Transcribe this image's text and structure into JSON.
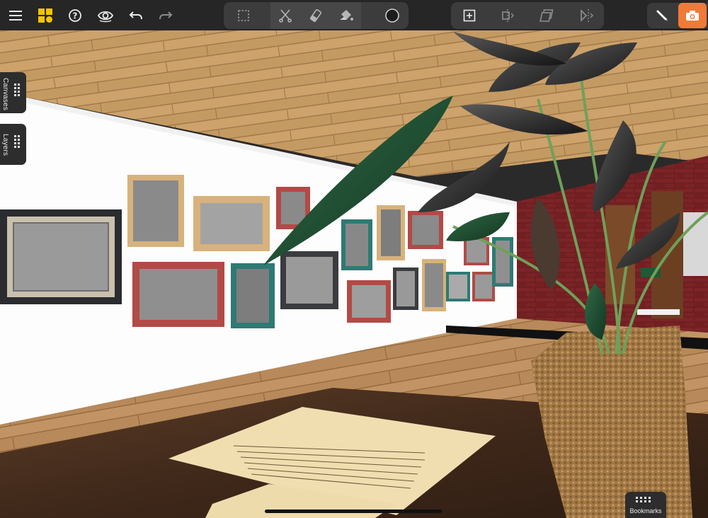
{
  "toolbar": {
    "left": [
      {
        "name": "menu-icon"
      },
      {
        "name": "app-logo-icon",
        "color": "#f5c400"
      },
      {
        "name": "help-icon"
      },
      {
        "name": "view-eye-icon"
      },
      {
        "name": "undo-icon"
      },
      {
        "name": "redo-icon"
      }
    ],
    "edit_tools": [
      {
        "name": "select-marquee-icon"
      },
      {
        "name": "cut-icon"
      },
      {
        "name": "eraser-icon"
      },
      {
        "name": "paint-bucket-icon"
      },
      {
        "name": "color-swatch-icon"
      }
    ],
    "object_tools": [
      {
        "name": "add-frame-icon"
      },
      {
        "name": "align-center-icon"
      },
      {
        "name": "duplicate-icon"
      },
      {
        "name": "mirror-icon"
      }
    ],
    "right": [
      {
        "name": "pen-mode-icon"
      },
      {
        "name": "camera-mode-icon",
        "active_color": "#f07a38"
      }
    ]
  },
  "side_tabs": {
    "canvases": "Canvases",
    "layers": "Layers"
  },
  "bookmarks": {
    "label": "Bookmarks"
  }
}
